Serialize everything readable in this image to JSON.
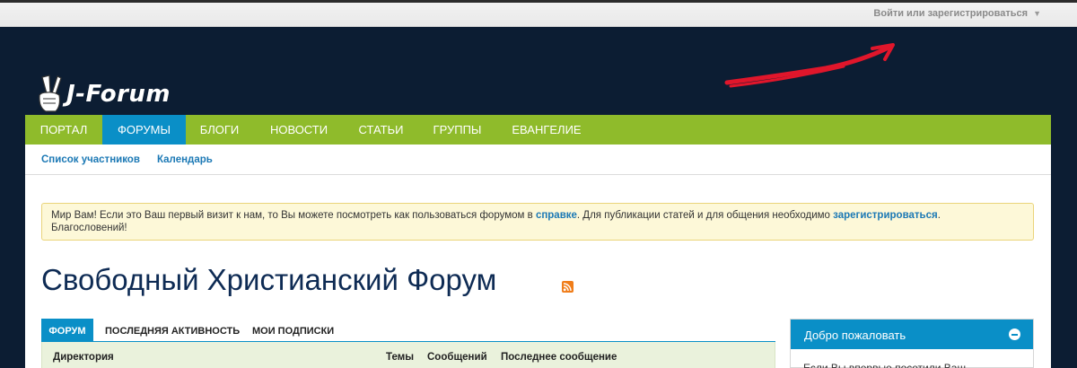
{
  "topbar": {
    "login_label": "Войти или зарегистрироваться",
    "caret": "▼"
  },
  "logo": {
    "text": "J-Forum",
    "icon": "victory-hand-icon"
  },
  "nav": {
    "tabs": [
      {
        "label": "ПОРТАЛ"
      },
      {
        "label": "ФОРУМЫ"
      },
      {
        "label": "БЛОГИ"
      },
      {
        "label": "НОВОСТИ"
      },
      {
        "label": "СТАТЬИ"
      },
      {
        "label": "ГРУППЫ"
      },
      {
        "label": "ЕВАНГЕЛИЕ"
      }
    ],
    "active_tab": "ФОРУМЫ"
  },
  "subnav": {
    "links": [
      {
        "label": "Список участников"
      },
      {
        "label": "Календарь"
      }
    ]
  },
  "notice": {
    "part1": "Мир Вам! Если это Ваш первый визит к нам, то Вы можете посмотреть как пользоваться форумом в ",
    "link1": "справке",
    "part2": ". Для публикации статей и для общения необходимо ",
    "link2": "зарегистрироваться",
    "part3": ".",
    "part4": "Благословений!"
  },
  "page": {
    "title": "Свободный Христианский Форум"
  },
  "forum_tabs": [
    {
      "label": "ФОРУМ"
    },
    {
      "label": "ПОСЛЕДНЯЯ АКТИВНОСТЬ"
    },
    {
      "label": "МОИ ПОДПИСКИ"
    }
  ],
  "table": {
    "columns": [
      "Директория",
      "Темы",
      "Сообщений",
      "Последнее сообщение"
    ]
  },
  "widget": {
    "title": "Добро пожаловать",
    "body": "Если Вы впервые посетили Ваш"
  },
  "colors": {
    "header_bg": "#0c1d33",
    "nav_green": "#8fbb2b",
    "accent_blue": "#0a8fc7",
    "title_navy": "#0e2b54",
    "annotation_red": "#e0162b"
  }
}
